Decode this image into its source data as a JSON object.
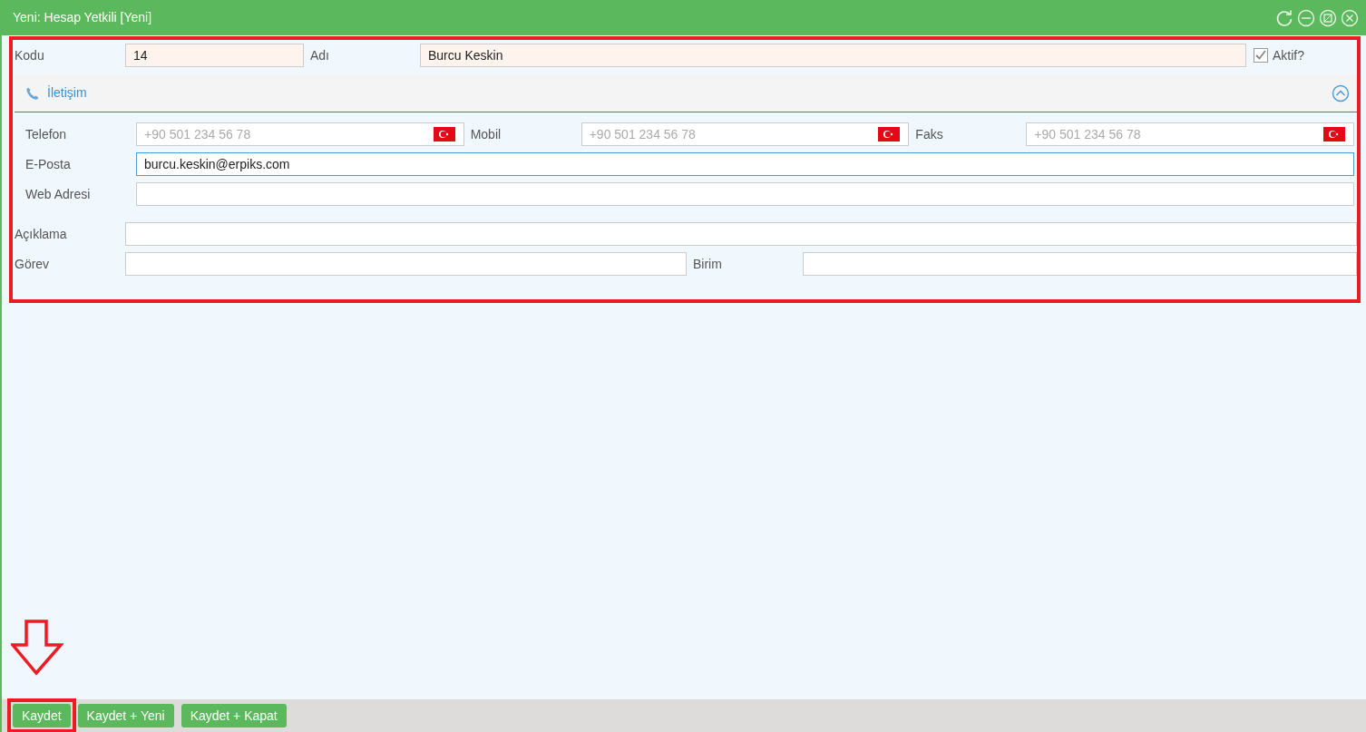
{
  "window": {
    "title": "Yeni: Hesap Yetkili [Yeni]"
  },
  "header_fields": {
    "code": {
      "label": "Kodu",
      "value": "14"
    },
    "name": {
      "label": "Adı",
      "value": "Burcu Keskin"
    },
    "active": {
      "label": "Aktif?",
      "checked": true
    }
  },
  "section": {
    "title": "İletişim",
    "expanded": true,
    "phones": [
      {
        "label": "Telefon",
        "placeholder": "+90 501 234 56 78"
      },
      {
        "label": "Mobil",
        "placeholder": "+90 501 234 56 78"
      },
      {
        "label": "Faks",
        "placeholder": "+90 501 234 56 78"
      }
    ],
    "email": {
      "label": "E-Posta",
      "value": "burcu.keskin@erpiks.com",
      "focused": true
    },
    "web": {
      "label": "Web Adresi"
    }
  },
  "description": {
    "label": "Açıklama"
  },
  "role": {
    "label": "Görev"
  },
  "unit": {
    "label": "Birim"
  },
  "buttons": [
    {
      "label": "Kaydet",
      "highlighted": true
    },
    {
      "label": "Kaydet + Yeni",
      "highlighted": false
    },
    {
      "label": "Kaydet + Kapat",
      "highlighted": false
    }
  ]
}
